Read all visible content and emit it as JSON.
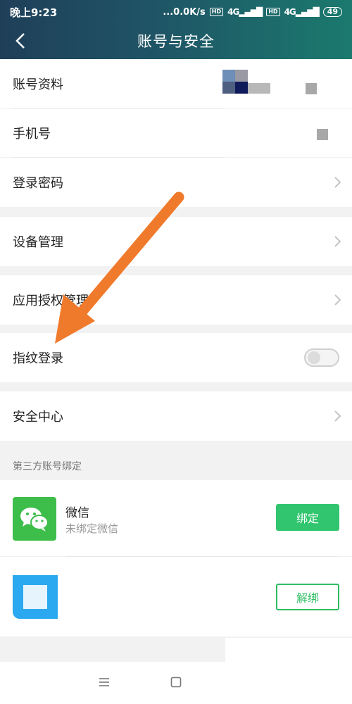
{
  "status_bar": {
    "time": "晚上9:23",
    "net_speed": "...0.0K/s",
    "hd": "HD",
    "signal_1": "4G",
    "signal_2": "4G",
    "battery": "49"
  },
  "header": {
    "title": "账号与安全"
  },
  "rows": {
    "account_profile": "账号资料",
    "phone": "手机号",
    "login_password": "登录密码",
    "device_management": "设备管理",
    "app_authorization": "应用授权管理",
    "fingerprint_login": "指纹登录",
    "security_center": "安全中心"
  },
  "fingerprint_toggle": {
    "enabled": false
  },
  "third_party": {
    "section_title": "第三方账号绑定",
    "wechat": {
      "name": "微信",
      "status": "未绑定微信",
      "action": "绑定"
    },
    "other": {
      "action": "解绑"
    }
  },
  "annotation": {
    "arrow_color": "#f07a2c"
  },
  "colors": {
    "accent_green": "#30c56e",
    "header_dark": "#1f3f59",
    "header_teal": "#1b7a6e"
  }
}
